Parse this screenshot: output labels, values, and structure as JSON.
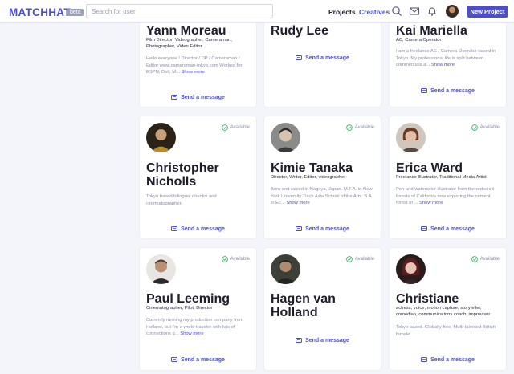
{
  "header": {
    "logo": "MATCHHAT",
    "beta": "beta",
    "search_placeholder": "Search for user",
    "nav": [
      "Projects",
      "Creatives"
    ],
    "new_project": "New Project",
    "icons": [
      "search-icon",
      "mail-icon",
      "bell-icon"
    ],
    "accent": "#4b4fc9"
  },
  "cards": [
    {
      "name": "Yann Moreau",
      "title": "Film Director, Videographer, Cameraman, Photographer, Video Editor",
      "bio": "Hello everyone ! Director / DP / Cameraman / Editor www.cameraman-tokyo.com Worked for ESPN, Dell, M...",
      "more": "Show more",
      "message": "Send a message"
    },
    {
      "name": "Rudy Lee",
      "title": "",
      "bio": "",
      "more": "",
      "message": "Send a message"
    },
    {
      "name": "Kai Mariella",
      "title": "AC, Camera Operator",
      "bio": "I am a freelance AC / Camera Operator based in Tokyo. My professional life is split between commercials a...",
      "more": "Show more",
      "message": "Send a message"
    },
    {
      "name": "Christopher Nicholls",
      "title": "",
      "bio": "Tokyo based bilingual director and cinematographer.",
      "more": "",
      "message": "Send a message",
      "available": "Available"
    },
    {
      "name": "Kimie Tanaka",
      "title": "Director, Writer, Editor, videographer",
      "bio": "Born and raised in Nagoya, Japan. M.F.A. in New York University Tisch Asia School of the Arts. B.A. in Ec...",
      "more": "Show more",
      "message": "Send a message",
      "available": "Available"
    },
    {
      "name": "Erica Ward",
      "title": "Freelance Illustrator, Traditional Media Artist",
      "bio": "Pen and watercolor illustrator from the redwood forests of California now exploring the cement forest of ...",
      "more": "Show more",
      "message": "Send a message",
      "available": "Available"
    },
    {
      "name": "Paul Leeming",
      "title": "Cinematographer, Pilot, Director",
      "bio": "Currently running my production company from Holland, but I'm a world traveler with lots of connections g...",
      "more": "Show more",
      "message": "Send a message",
      "available": "Available"
    },
    {
      "name": "Hagen van Holland",
      "title": "",
      "bio": "",
      "more": "",
      "message": "Send a message",
      "available": "Available"
    },
    {
      "name": "Christiane",
      "title": "actress, voice, motion capture, storyteller, comedian, communications coach, improvisor",
      "bio": "Tokyo based. Globally free. Multi-talented British female.",
      "more": "",
      "message": "Send a message",
      "available": "Available"
    }
  ]
}
